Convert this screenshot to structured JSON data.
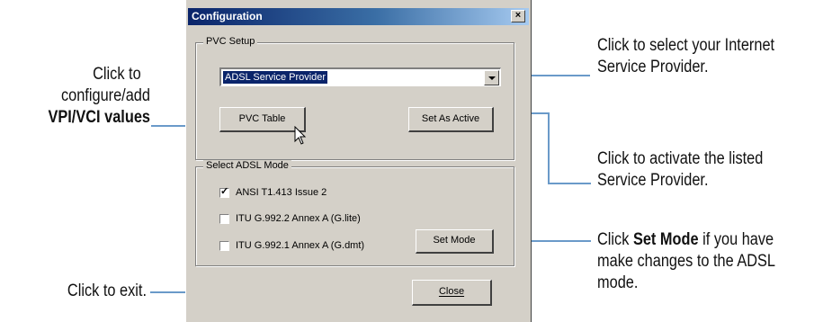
{
  "dialog": {
    "title": "Configuration",
    "close_glyph": "×",
    "pvc_setup": {
      "legend": "PVC Setup",
      "provider_value": "ADSL Service Provider",
      "pvc_table_button": "PVC Table",
      "set_as_active_button": "Set As Active"
    },
    "adsl_mode": {
      "legend": "Select ADSL Mode",
      "options": [
        {
          "label": "ANSI T1.413 Issue 2",
          "checked": true
        },
        {
          "label": "ITU G.992.2 Annex A (G.lite)",
          "checked": false
        },
        {
          "label": "ITU G.992.1 Annex A (G.dmt)",
          "checked": false
        }
      ],
      "check_glyph": "✓",
      "set_mode_button": "Set Mode"
    },
    "close_button": "Close"
  },
  "annotations": {
    "pvc_line1": "Click to",
    "pvc_line2": "configure/add",
    "pvc_line3": "VPI/VCI values",
    "exit": "Click to exit.",
    "provider_line1": "Click to select your Internet",
    "provider_line2": "Service  Provider.",
    "activate_line1": "Click to activate the listed",
    "activate_line2": "Service Provider.",
    "setmode_pre": "Click ",
    "setmode_bold": "Set Mode",
    "setmode_post": " if you have",
    "setmode_line2": "make changes to the ADSL",
    "setmode_line3": "mode."
  },
  "colors": {
    "dialog_bg": "#d4d0c8",
    "titlebar_start": "#0a246a",
    "leader_line": "#6a9ac9"
  }
}
